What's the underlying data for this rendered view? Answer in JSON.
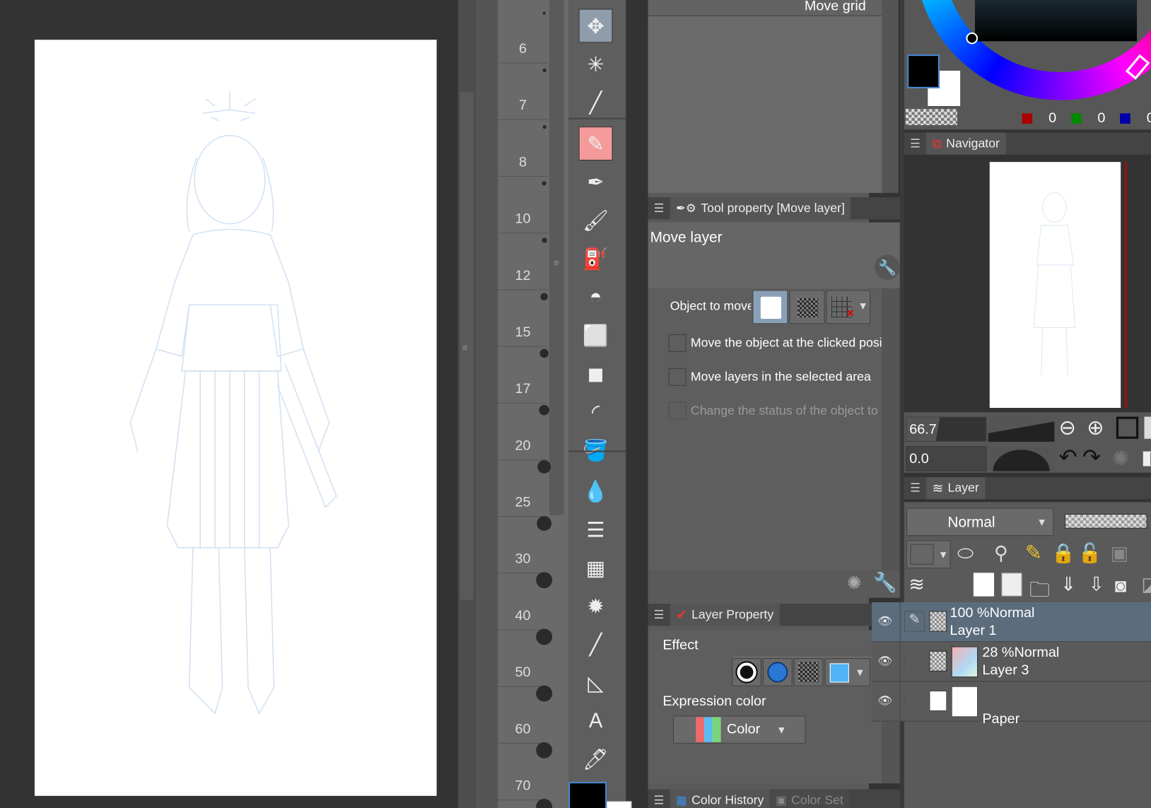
{
  "ruler": {
    "labels": [
      "6",
      "7",
      "8",
      "10",
      "12",
      "15",
      "17",
      "20",
      "25",
      "30",
      "40",
      "50",
      "60",
      "70"
    ]
  },
  "tool_panel": {
    "header_top_label": "Move grid"
  },
  "tool_property": {
    "tab_label": "Tool property [Move layer]",
    "title": "Move layer",
    "object_to_move_label": "Object to move",
    "opt1": "Move the object at the clicked posi",
    "opt2": "Move layers in the selected area",
    "opt3": "Change the status of the object to"
  },
  "layer_property": {
    "tab_label": "Layer Property",
    "effect_label": "Effect",
    "expression_color_label": "Expression color",
    "expression_color_value": "Color"
  },
  "color_history": {
    "tab_label": "Color History",
    "tab2_label": "Color Set",
    "swatches": [
      "#000000",
      "#1e90ff",
      "#ffff00",
      "#ff0000",
      "#7fff00",
      "#00cc00",
      "#ff2020",
      "#ff6600",
      "#80ff00",
      "#66dd00",
      "#aaff00",
      "#ffdd00",
      "#ffaa00",
      "#ff0000",
      "#0000ff",
      "#ffffff"
    ]
  },
  "color_wheel": {
    "r": "0",
    "g": "0",
    "b": "0"
  },
  "navigator": {
    "tab_label": "Navigator",
    "zoom": "66.7",
    "rotate": "0.0"
  },
  "layer": {
    "tab_label": "Layer",
    "blend_mode": "Normal",
    "opacity": "100",
    "layers": [
      {
        "mode": "100 %Normal",
        "name": "Layer 1"
      },
      {
        "mode": "28 %Normal",
        "name": "Layer 3"
      },
      {
        "mode": "",
        "name": "Paper"
      }
    ]
  }
}
